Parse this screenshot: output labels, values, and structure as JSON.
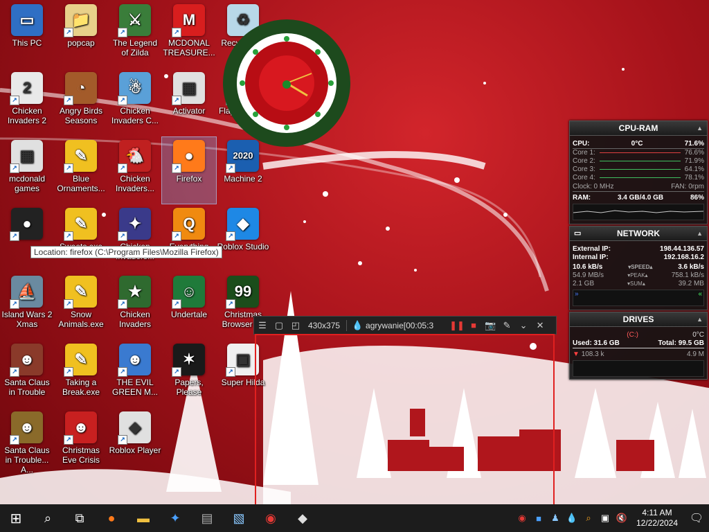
{
  "desktop": {
    "icons": [
      {
        "label": "This PC",
        "glyph": "▭",
        "bg": "#2f6fc4"
      },
      {
        "label": "popcap",
        "glyph": "📁",
        "bg": "#e8d08a"
      },
      {
        "label": "The Legend of Zilda",
        "glyph": "⚔",
        "bg": "#3a7d3a"
      },
      {
        "label": "MCDONAL TREASURE...",
        "glyph": "M",
        "bg": "#d81e1e"
      },
      {
        "label": "Recycle Bin",
        "glyph": "♻",
        "bg": "#b8d8e8"
      },
      {
        "label": "Chicken Invaders 2",
        "glyph": "2",
        "bg": "#e9e9e9"
      },
      {
        "label": "Angry Birds Seasons",
        "glyph": "◔",
        "bg": "#a35b2a"
      },
      {
        "label": "Chicken Invaders C...",
        "glyph": "☃",
        "bg": "#5aa0d8"
      },
      {
        "label": "Activator",
        "glyph": "▦",
        "bg": "#e0e0e0"
      },
      {
        "label": "Flappy Plane",
        "glyph": "✈",
        "bg": "#7aa0c0"
      },
      {
        "label": "mcdonald games",
        "glyph": "▦",
        "bg": "#e0e0e0"
      },
      {
        "label": "Blue Ornaments...",
        "glyph": "✎",
        "bg": "#f0c020"
      },
      {
        "label": "Chicken Invaders...",
        "glyph": "🐔",
        "bg": "#c02020"
      },
      {
        "label": "Firefox",
        "glyph": "●",
        "bg": "#ff7a1a"
      },
      {
        "label": "Machine 2",
        "glyph": "2020",
        "bg": "#1b5fb0"
      },
      {
        "label": "",
        "glyph": "●",
        "bg": "#222222"
      },
      {
        "label": "Sweets.exe",
        "glyph": "✎",
        "bg": "#f0c020"
      },
      {
        "label": "Chicken Invaders...",
        "glyph": "✦",
        "bg": "#3a3a8a"
      },
      {
        "label": "Everything",
        "glyph": "Q",
        "bg": "#f08a10"
      },
      {
        "label": "Roblox Studio",
        "glyph": "◆",
        "bg": "#1e88e5"
      },
      {
        "label": "Island Wars 2 Xmas",
        "glyph": "⛵",
        "bg": "#6a8aa0"
      },
      {
        "label": "Snow Animals.exe",
        "glyph": "✎",
        "bg": "#f0c020"
      },
      {
        "label": "Chicken Invaders",
        "glyph": "★",
        "bg": "#2f6a2f"
      },
      {
        "label": "Undertale",
        "glyph": "☺",
        "bg": "#1f7a3a"
      },
      {
        "label": "Christmas Browser 99",
        "glyph": "99",
        "bg": "#1b4d1b"
      },
      {
        "label": "Santa Claus in Trouble",
        "glyph": "☻",
        "bg": "#8a3a2a"
      },
      {
        "label": "Taking a Break.exe",
        "glyph": "✎",
        "bg": "#f0c020"
      },
      {
        "label": "THE EVIL GREEN M...",
        "glyph": "☻",
        "bg": "#3a7ad0"
      },
      {
        "label": "Papers, Please",
        "glyph": "✶",
        "bg": "#1a1a1a"
      },
      {
        "label": "Super Hilda",
        "glyph": "▣",
        "bg": "#f0f0f0"
      },
      {
        "label": "Santa Claus in Trouble... A...",
        "glyph": "☻",
        "bg": "#8a6a2a"
      },
      {
        "label": "Christmas Eve Crisis",
        "glyph": "☻",
        "bg": "#c82020"
      },
      {
        "label": "Roblox Player",
        "glyph": "◆",
        "bg": "#e0e0e0"
      }
    ],
    "tooltip": "Location: firefox (C:\\Program Files\\Mozilla Firefox)"
  },
  "cpu_ram": {
    "title": "CPU-RAM",
    "cpu_label": "CPU:",
    "cpu_temp": "0°C",
    "cpu_pct": "71.6%",
    "cores": [
      {
        "label": "Core 1:",
        "pct": "76.6%"
      },
      {
        "label": "Core 2:",
        "pct": "71.9%"
      },
      {
        "label": "Core 3:",
        "pct": "64.1%"
      },
      {
        "label": "Core 4:",
        "pct": "78.1%"
      }
    ],
    "clock": "Clock: 0 MHz",
    "fan": "FAN: 0rpm",
    "ram_label": "RAM:",
    "ram_value": "3.4 GB/4.0 GB",
    "ram_pct": "86%"
  },
  "network": {
    "title": "NETWORK",
    "ext_label": "External IP:",
    "ext_ip": "198.44.136.57",
    "int_label": "Internal IP:",
    "int_ip": "192.168.16.2",
    "speed_down": "10.6 kB/s",
    "speed_label": "SPEED",
    "speed_up": "3.6 kB/s",
    "peak_down": "54.9 MB/s",
    "peak_label": "PEAK",
    "peak_up": "758.1 kB/s",
    "sum_down": "2.1 GB",
    "sum_label": "SUM",
    "sum_up": "39.2 MB"
  },
  "drives": {
    "title": "DRIVES",
    "drive": "(C:)",
    "temp": "0°C",
    "used": "Used: 31.6 GB",
    "total": "Total: 99.5 GB",
    "read": "108.3 k",
    "write": "4.9 M"
  },
  "recorder": {
    "size": "430x375",
    "title": "agrywanie[00:05:3"
  },
  "taskbar": {
    "time": "4:11 AM",
    "date": "12/22/2024"
  }
}
